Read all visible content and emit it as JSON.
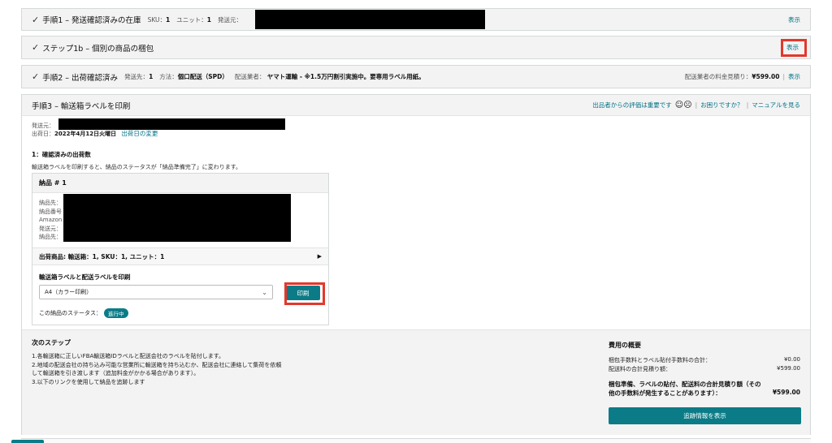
{
  "step1": {
    "title": "手順1 – 発送確認済みの在庫",
    "sku_label": "SKU：",
    "sku_value": "1",
    "unit_label": "ユニット：",
    "unit_value": "1",
    "ship_from_label": "発送元：",
    "view_link": "表示"
  },
  "step1b": {
    "title": "ステップ1b – 個別の商品の梱包",
    "view_link": "表示"
  },
  "step2": {
    "title": "手順2 – 出荷確認済み",
    "ship_to_label": "発送先：",
    "ship_to_value": "1",
    "method_label": "方法：",
    "method_value": "個口配送（SPD）",
    "carrier_label": "配送業者：",
    "carrier_value": "ヤマト運輸 - ※1.5万円割引実施中。要専用ラベル用紙。",
    "estimate_label": "配送業者の料金見積り：",
    "estimate_value": "¥599.00",
    "view_link": "表示"
  },
  "step3": {
    "title": "手順3 – 輸送箱ラベルを印刷",
    "feedback_text": "出品者からの評価は重要です",
    "help_link": "お困りですか？",
    "manual_link": "マニュアルを見る",
    "ship_from_label": "発送元：",
    "ship_date_label": "出荷日：",
    "ship_date_value": "2022年4月12日火曜日",
    "change_date_link": "出荷日の変更",
    "confirmed_heading": "1：確認済みの出荷数",
    "print_note": "輸送箱ラベルを印刷すると、納品のステータスが「納品準備完了」に変わります。",
    "shipment": {
      "title": "納品 # 1",
      "detail_labels": [
        "納品先：",
        "納品番号",
        "Amazon",
        "発送元：",
        "納品先："
      ],
      "items_summary": "出荷商品: 輸送箱：1, SKU：1, ユニット：1",
      "print_heading": "輸送箱ラベルと配送ラベルを印刷",
      "paper_select": "A4（カラー印刷）",
      "print_button": "印刷",
      "status_label": "この納品のステータス：",
      "status_badge": "進行中"
    }
  },
  "next_steps": {
    "heading": "次のステップ",
    "lines": [
      "1.各輸送箱に正しいFBA輸送箱IDラベルと配送会社のラベルを貼付します。",
      "2.地域の配送会社の持ち込み可能な営業所に輸送箱を持ち込むか、配送会社に連絡して集荷を依頼",
      "して輸送箱を引き渡します（追加料金がかかる場合があります）。",
      "3.以下のリンクを使用して納品を追跡します"
    ]
  },
  "cost_summary": {
    "heading": "費用の概要",
    "fee_label": "梱包手数料とラベル貼付手数料の合計：",
    "fee_value": "¥0.00",
    "shipping_label": "配送料の合計見積り額：",
    "shipping_value": "¥599.00",
    "total_label_1": "梱包準備、ラベルの貼付、配送料の合計見積り額（その",
    "total_label_2": "他の手数料が発生することがあります）：",
    "total_value": "¥599.00",
    "track_button": "追跡情報を表示"
  }
}
